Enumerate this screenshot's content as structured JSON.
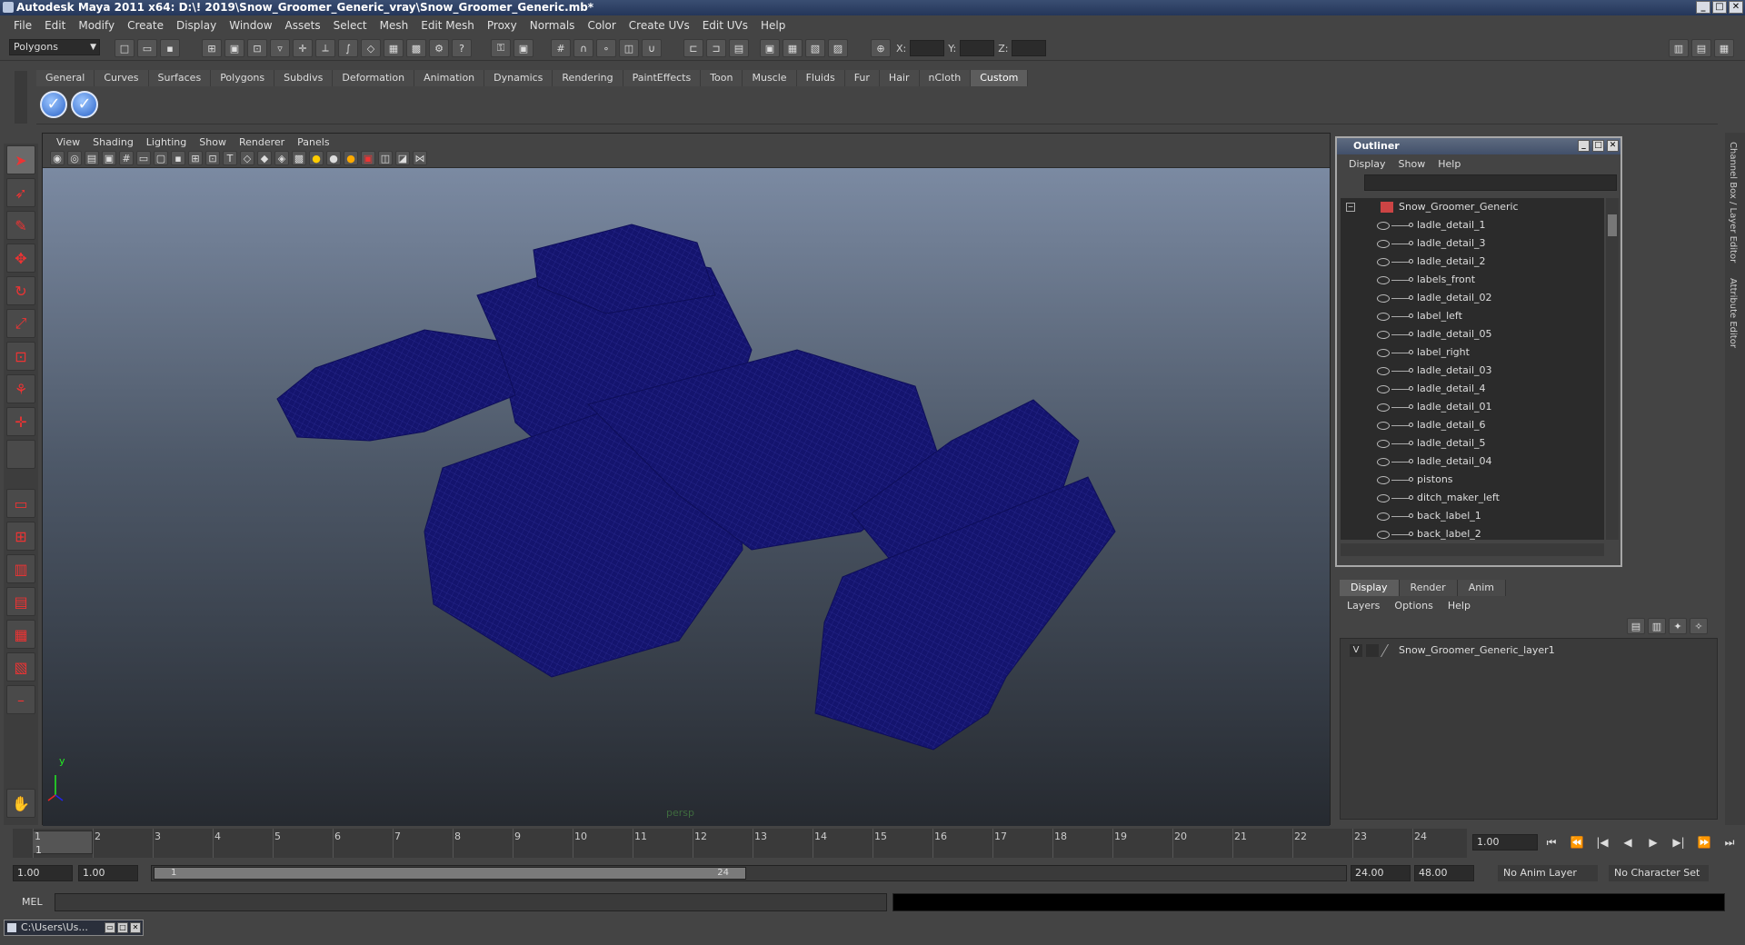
{
  "window": {
    "title": "Autodesk Maya 2011 x64: D:\\! 2019\\Snow_Groomer_Generic_vray\\Snow_Groomer_Generic.mb*",
    "buttons": [
      "_",
      "□",
      "✕"
    ]
  },
  "menubar": {
    "items": [
      "File",
      "Edit",
      "Modify",
      "Create",
      "Display",
      "Window",
      "Assets",
      "Select",
      "Mesh",
      "Edit Mesh",
      "Proxy",
      "Normals",
      "Color",
      "Create UVs",
      "Edit UVs",
      "Help"
    ]
  },
  "statusline": {
    "mode_value": "Polygons",
    "x_label": "X:",
    "y_label": "Y:",
    "z_label": "Z:"
  },
  "shelf": {
    "tabs": [
      "General",
      "Curves",
      "Surfaces",
      "Polygons",
      "Subdivs",
      "Deformation",
      "Animation",
      "Dynamics",
      "Rendering",
      "PaintEffects",
      "Toon",
      "Muscle",
      "Fluids",
      "Fur",
      "Hair",
      "nCloth",
      "Custom"
    ],
    "active_tab": "Custom",
    "buttons": [
      "check-button",
      "check-button"
    ]
  },
  "viewport": {
    "menu": [
      "View",
      "Shading",
      "Lighting",
      "Show",
      "Renderer",
      "Panels"
    ],
    "camera_label": "persp",
    "axis_y": "y",
    "wire_color": "#14146e"
  },
  "outliner": {
    "title": "Outliner",
    "menu": [
      "Display",
      "Show",
      "Help"
    ],
    "root": "Snow_Groomer_Generic",
    "items": [
      "ladle_detail_1",
      "ladle_detail_3",
      "ladle_detail_2",
      "labels_front",
      "ladle_detail_02",
      "label_left",
      "ladle_detail_05",
      "label_right",
      "ladle_detail_03",
      "ladle_detail_4",
      "ladle_detail_01",
      "ladle_detail_6",
      "ladle_detail_5",
      "ladle_detail_04",
      "pistons",
      "ditch_maker_left",
      "back_label_1",
      "back_label_2"
    ]
  },
  "layer_editor": {
    "tabs": [
      "Display",
      "Render",
      "Anim"
    ],
    "active_tab": "Display",
    "menu": [
      "Layers",
      "Options",
      "Help"
    ],
    "layer_visible": "V",
    "layer_name": "Snow_Groomer_Generic_layer1"
  },
  "side_tabs": [
    "Channel Box / Layer Editor",
    "Attribute Editor"
  ],
  "timeline": {
    "frames": [
      "1",
      "2",
      "3",
      "4",
      "5",
      "6",
      "7",
      "8",
      "9",
      "10",
      "11",
      "12",
      "13",
      "14",
      "15",
      "16",
      "17",
      "18",
      "19",
      "20",
      "21",
      "22",
      "23",
      "24"
    ],
    "current_frame_marker": "1",
    "current_frame": "1.00",
    "playback_buttons": [
      "⏮",
      "⏪",
      "|◀",
      "◀",
      "▶",
      "▶|",
      "⏩",
      "⏭"
    ]
  },
  "range": {
    "start": "1.00",
    "playback_start": "1.00",
    "thumb_start": "1",
    "thumb_end": "24",
    "playback_end": "24.00",
    "end": "48.00",
    "anim_layer": "No Anim Layer",
    "character_set": "No Character Set"
  },
  "command_line": {
    "label": "MEL"
  },
  "taskbar": {
    "item": "C:\\Users\\Us..."
  }
}
